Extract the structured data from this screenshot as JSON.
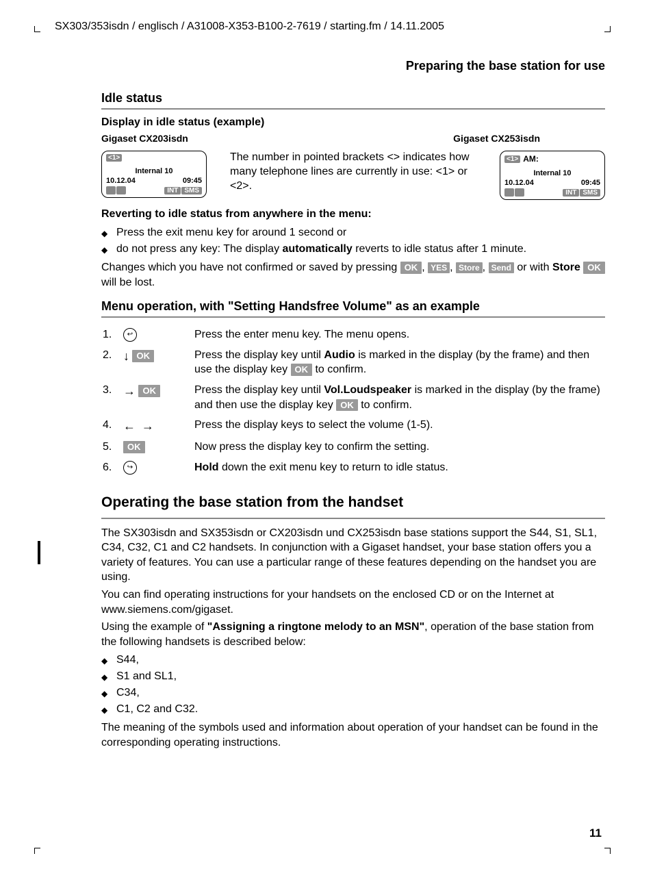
{
  "header_path": "SX303/353isdn / englisch / A31008-X353-B100-2-7619 / starting.fm / 14.11.2005",
  "section_title": "Preparing the base station for use",
  "idle": {
    "heading": "Idle status",
    "sub": "Display in idle status (example)",
    "model_left": "Gigaset CX203isdn",
    "model_right": "Gigaset CX253isdn",
    "explain": "The number in pointed brackets <> indicates how many telephone lines are currently in use: <1> or <2>.",
    "display_left": {
      "line1_tag": "<1>",
      "line1_extra": "",
      "internal": "Internal 10",
      "date": "10.12.04",
      "time": "09:45",
      "btn1": "INT",
      "btn2": "SMS"
    },
    "display_right": {
      "line1_tag": "<1>",
      "line1_extra": "AM:",
      "internal": "Internal 10",
      "date": "10.12.04",
      "time": "09:45",
      "btn1": "INT",
      "btn2": "SMS"
    }
  },
  "revert": {
    "heading": "Reverting to idle status from anywhere in the menu:",
    "b1": "Press the exit menu key for around 1 second or",
    "b2_pre": "do not press any key: The display ",
    "b2_bold": "automatically",
    "b2_post": " reverts to idle status after 1 minute.",
    "para_pre": "Changes which you have not confirmed or saved by pressing ",
    "btn_ok": "OK",
    "btn_yes": "YES",
    "btn_store": "Store",
    "btn_send": "Send",
    "para_mid": " or with ",
    "bold_store": "Store",
    "para_end": " will be lost."
  },
  "menu_op": {
    "heading": "Menu operation, with \"Setting Handsfree Volume\" as an example",
    "steps": [
      {
        "n": "1.",
        "icon": "enter",
        "btn": "",
        "text_pre": "Press the enter menu key. The menu opens.",
        "bold": "",
        "text_post": ""
      },
      {
        "n": "2.",
        "icon": "down",
        "btn": "OK",
        "text_pre": "Press the display key until ",
        "bold": "Audio",
        "text_post": " is marked in the display (by the frame) and then use the display key ",
        "btn2": "OK",
        "text_post2": " to confirm."
      },
      {
        "n": "3.",
        "icon": "right",
        "btn": "OK",
        "text_pre": "Press the display key until ",
        "bold": "Vol.Loudspeaker",
        "text_post": " is marked in the display (by the frame) and then use the display key ",
        "btn2": "OK",
        "text_post2": " to confirm."
      },
      {
        "n": "4.",
        "icon": "leftright",
        "btn": "",
        "text_pre": "Press the display keys to select the volume (1-5).",
        "bold": "",
        "text_post": ""
      },
      {
        "n": "5.",
        "icon": "",
        "btn": "OK",
        "text_pre": "Now press the display key to confirm the setting.",
        "bold": "",
        "text_post": ""
      },
      {
        "n": "6.",
        "icon": "exit",
        "btn": "",
        "text_pre": "",
        "bold": "Hold",
        "text_post": " down the exit menu key to return to idle status."
      }
    ]
  },
  "operating": {
    "heading": "Operating the base station from the handset",
    "p1": "The SX303isdn and SX353isdn or CX203isdn und CX253isdn base stations support the S44, S1, SL1, C34, C32, C1 and C2 handsets. In conjunction with a Gigaset handset, your base station offers you a variety of features. You can use a particular range of these features depending on the handset you are using.",
    "p2": "You can find operating instructions for your handsets on the enclosed CD or on the Internet at www.siemens.com/gigaset.",
    "p3_pre": "Using the example of ",
    "p3_bold": "\"Assigning a ringtone melody to an MSN\"",
    "p3_post": ", operation of the base station from the following handsets is described below:",
    "list": [
      "S44,",
      "S1 and SL1,",
      "C34,",
      "C1, C2 and C32."
    ],
    "p4": "The meaning of the symbols used and information about operation of your handset can be found in the corresponding operating instructions."
  },
  "page_num": "11"
}
